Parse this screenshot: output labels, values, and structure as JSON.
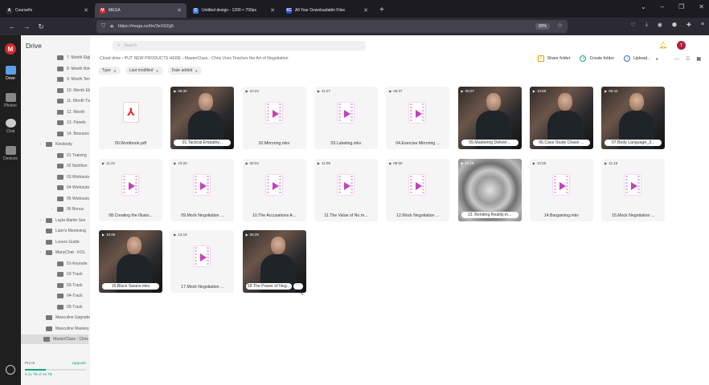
{
  "browser": {
    "tabs": [
      {
        "title": "Coursefix",
        "icon_text": "A",
        "icon_color": "#333333",
        "active": false
      },
      {
        "title": "MEGA",
        "icon_text": "M",
        "icon_color": "#d9272e",
        "active": true
      },
      {
        "title": "Untitled design - 1200 × 700px",
        "icon_text": "C",
        "icon_color": "#3b82f6",
        "active": false
      },
      {
        "title": "All Your Downloadable Files",
        "icon_text": "XC",
        "icon_color": "#2b4bd6",
        "active": false
      }
    ],
    "url": "https://mega.nz/fm/3eX0Zg5",
    "zoom": "80%"
  },
  "rail": {
    "items": [
      {
        "label": "Drive"
      },
      {
        "label": "Photos"
      },
      {
        "label": "Chat"
      },
      {
        "label": "Devices"
      }
    ]
  },
  "sidebar": {
    "title": "Drive",
    "tree": [
      {
        "label": "7. Month Eight",
        "indent": 2,
        "arrow": false
      },
      {
        "label": "8. Month Nine",
        "indent": 2,
        "arrow": false
      },
      {
        "label": "9. Month Ten",
        "indent": 2,
        "arrow": false
      },
      {
        "label": "10. Month Eleven",
        "indent": 2,
        "arrow": false
      },
      {
        "label": "11. Month Twelve",
        "indent": 2,
        "arrow": false
      },
      {
        "label": "12. Month",
        "indent": 2,
        "arrow": false
      },
      {
        "label": "13. Panels",
        "indent": 2,
        "arrow": false
      },
      {
        "label": "14. Bonuses",
        "indent": 2,
        "arrow": false
      },
      {
        "label": "Klnobody",
        "indent": 1,
        "arrow": true
      },
      {
        "label": "01 Training",
        "indent": 2,
        "arrow": false
      },
      {
        "label": "02 Nutrition",
        "indent": 2,
        "arrow": false
      },
      {
        "label": "03 Workouts",
        "indent": 2,
        "arrow": false
      },
      {
        "label": "04 Workouts",
        "indent": 2,
        "arrow": false
      },
      {
        "label": "05 Workouts",
        "indent": 2,
        "arrow": false
      },
      {
        "label": "06 Bonus",
        "indent": 2,
        "arrow": true
      },
      {
        "label": "Layla Martin Sex",
        "indent": 1,
        "arrow": true
      },
      {
        "label": "Liam's Mentoring",
        "indent": 1,
        "arrow": false
      },
      {
        "label": "Lovers Guide",
        "indent": 1,
        "arrow": false
      },
      {
        "label": "ManyChat - KOL",
        "indent": 1,
        "arrow": true
      },
      {
        "label": "01-Keynote",
        "indent": 2,
        "arrow": false
      },
      {
        "label": "02-Track",
        "indent": 2,
        "arrow": false
      },
      {
        "label": "03-Track",
        "indent": 2,
        "arrow": false
      },
      {
        "label": "04-Track",
        "indent": 2,
        "arrow": false
      },
      {
        "label": "05-Track",
        "indent": 2,
        "arrow": false
      },
      {
        "label": "Masculine Upgrade",
        "indent": 1,
        "arrow": false
      },
      {
        "label": "Masculine Mastery",
        "indent": 1,
        "arrow": false
      },
      {
        "label": "MasterClass - Chris",
        "indent": 1,
        "arrow": false,
        "selected": true
      }
    ],
    "quota": {
      "plan": "Pro III",
      "upgrade": "Upgrade",
      "used_text": "5.41 TB of 16 TB",
      "used_fraction": 0.34
    }
  },
  "topbar": {
    "search_placeholder": "Search"
  },
  "breadcrumb": {
    "text": "Cloud drive  ›  PUT NEW PRODUCTS HERE  ›  MasterClass - Chris Voss Teaches the Art of Negotiation"
  },
  "actions": {
    "share": "Share folder",
    "create": "Create folder",
    "upload": "Upload..."
  },
  "filters": [
    {
      "label": "Type"
    },
    {
      "label": "Last modified"
    },
    {
      "label": "Date added"
    }
  ],
  "files": [
    {
      "name": "00.Workbook.pdf",
      "kind": "pdf",
      "duration": ""
    },
    {
      "name": "01.Tactical Empathy...",
      "kind": "photo",
      "duration": "05:30"
    },
    {
      "name": "02.Mirroring.mkv",
      "kind": "icon",
      "duration": "10:23"
    },
    {
      "name": "03.Labeling.mkv",
      "kind": "icon",
      "duration": "11:27"
    },
    {
      "name": "04.Exercise Mirroring ...",
      "kind": "icon",
      "duration": "06:37"
    },
    {
      "name": "05.Mastering Deliver...",
      "kind": "photo",
      "duration": "09:07"
    },
    {
      "name": "06.Case Study Chase ...",
      "kind": "photo",
      "duration": "10:58"
    },
    {
      "name": "07.Body Language_3...",
      "kind": "photo",
      "duration": "08:44"
    },
    {
      "name": "08.Creating the Illusio...",
      "kind": "icon",
      "duration": "11:22"
    },
    {
      "name": "09.Mock Negotiation ...",
      "kind": "icon",
      "duration": "10:20"
    },
    {
      "name": "10.The Accusations A...",
      "kind": "icon",
      "duration": "08:04"
    },
    {
      "name": "11.The Value of No.m...",
      "kind": "icon",
      "duration": "11:09"
    },
    {
      "name": "12.Mock Negotiation ...",
      "kind": "icon",
      "duration": "08:00"
    },
    {
      "name": "13. Bending Reality.m...",
      "kind": "metal",
      "duration": "11:18"
    },
    {
      "name": "14.Bargaining.mkv",
      "kind": "icon",
      "duration": "13:25"
    },
    {
      "name": "15.Mock Negotiation ...",
      "kind": "icon",
      "duration": "11:15"
    },
    {
      "name": "16.Black Swans.mkv",
      "kind": "photo",
      "duration": "10:06"
    },
    {
      "name": "17.Mock Negotiation ...",
      "kind": "icon",
      "duration": "13:15"
    },
    {
      "name": "18.The Power of Neg...",
      "kind": "photo",
      "duration": "06:29",
      "hovered": true
    }
  ]
}
